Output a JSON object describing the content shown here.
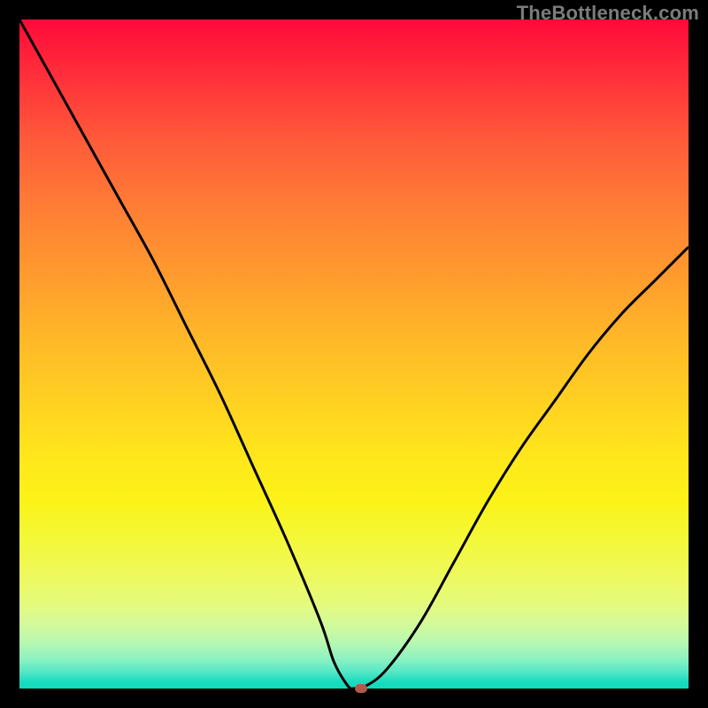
{
  "watermark": "TheBottleneck.com",
  "colors": {
    "frame": "#000000",
    "curve": "#000000",
    "marker": "#b25a49"
  },
  "chart_data": {
    "type": "line",
    "title": "",
    "xlabel": "",
    "ylabel": "",
    "xlim": [
      0,
      100
    ],
    "ylim": [
      0,
      100
    ],
    "grid": false,
    "series": [
      {
        "name": "bottleneck-curve",
        "x": [
          0,
          5,
          10,
          15,
          20,
          25,
          30,
          35,
          40,
          45,
          47,
          49,
          50,
          52,
          55,
          60,
          65,
          70,
          75,
          80,
          85,
          90,
          95,
          100
        ],
        "values": [
          100,
          91,
          82,
          73,
          64,
          54,
          44,
          33,
          22,
          10,
          4,
          0.5,
          0,
          0.5,
          3,
          10,
          19,
          28,
          36,
          43,
          50,
          56,
          61,
          66
        ]
      }
    ],
    "marker": {
      "x": 51,
      "y": 0,
      "color": "#b25a49"
    },
    "background_gradient": {
      "top": "#ff0a3a",
      "mid": "#ffe81b",
      "bottom": "#14d9bb"
    }
  }
}
